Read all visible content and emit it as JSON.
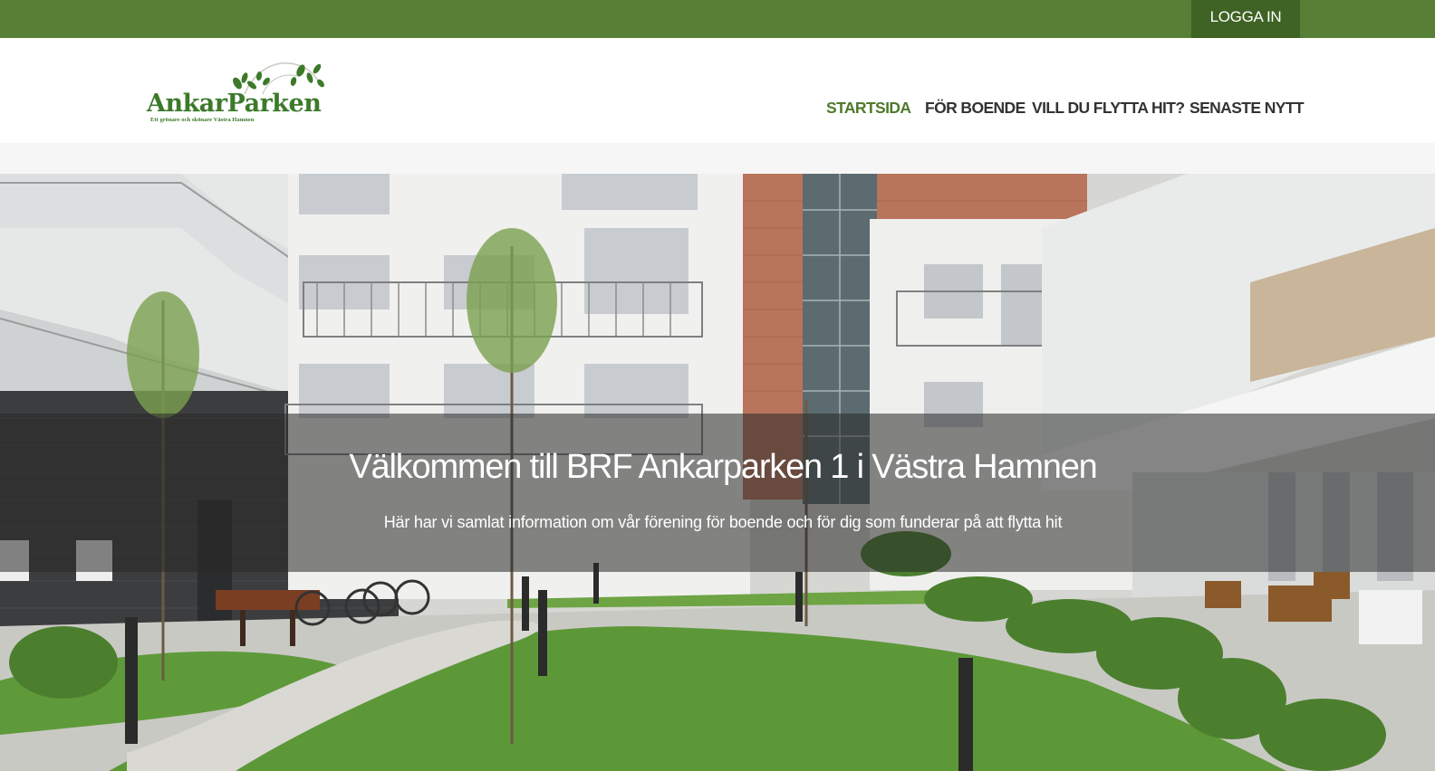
{
  "topbar": {
    "login_label": "LOGGA IN"
  },
  "logo": {
    "name": "AnkarParken",
    "tagline": "Ett grönare och skönare Västra Hamnen"
  },
  "nav": {
    "items": [
      {
        "label": "STARTSIDA",
        "active": true
      },
      {
        "label": "FÖR BOENDE",
        "active": false
      },
      {
        "label": "VILL DU FLYTTA HIT?",
        "active": false
      },
      {
        "label": "SENASTE NYTT",
        "active": false
      }
    ]
  },
  "hero": {
    "title": "Välkommen till BRF Ankarparken 1 i Västra Hamnen",
    "subtitle": "Här har vi samlat information om vår förening för boende och för dig som funderar på att flytta hit"
  },
  "colors": {
    "topbar": "#577f35",
    "login_button": "#3f6324",
    "nav_active": "#4f7a2e",
    "nav_text": "#333333",
    "logo_green": "#3c7a2a"
  }
}
